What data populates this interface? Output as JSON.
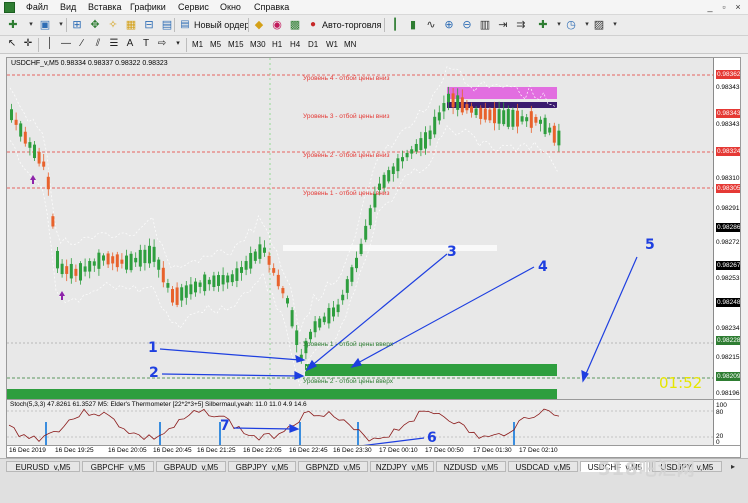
{
  "menu": {
    "items": [
      "Файл",
      "Вид",
      "Вставка",
      "Графики",
      "Сервис",
      "Окно",
      "Справка"
    ],
    "window_controls": [
      "_",
      "▫",
      "×"
    ]
  },
  "toolbar": {
    "new_order_label": "Новый ордер",
    "auto_trading_label": "Авто-торговля",
    "timeframes": [
      "M1",
      "M5",
      "M15",
      "M30",
      "H1",
      "H4",
      "D1",
      "W1",
      "MN"
    ]
  },
  "chart": {
    "title": "USDCHF_v,M5  0.98334 0.98337 0.98322 0.98323",
    "price_labels": [
      "0.98362",
      "0.98343",
      "0.98324",
      "0.98310",
      "0.98305",
      "0.98291",
      "0.98286",
      "0.98272",
      "0.98267",
      "0.98253",
      "0.98248",
      "0.98234",
      "0.98228",
      "0.98215",
      "0.98209",
      "0.98196"
    ],
    "levels": {
      "l4": "Уровень 4 - отбой цены вниз",
      "l3": "Уровень 3 - отбой цены вниз",
      "l2": "Уровень 2 - отбой цены вниз",
      "l1": "Уровень 1 - отбой цены вниз",
      "s1": "Уровень 1 - отбой цены вверх",
      "s2": "Уровень 2 - отбой цены вверх"
    },
    "annotations": [
      "1",
      "2",
      "3",
      "4",
      "5",
      "6",
      "7"
    ],
    "clock": "01:52"
  },
  "indicator": {
    "title": "Stoch(5,3,3) 47.8261 61.3527   M5: Elder's Thermometer [22*2*3+5] Silbermaul,yeah: 11.0 11.0 4.9 14.6",
    "axis_labels": [
      "100",
      "80",
      "20",
      "0"
    ]
  },
  "time_axis": {
    "labels": [
      "16 Dec 2019",
      "16 Dec 19:25",
      "16 Dec 20:05",
      "16 Dec 20:45",
      "16 Dec 21:25",
      "16 Dec 22:05",
      "16 Dec 22:45",
      "16 Dec 23:30",
      "17 Dec 00:10",
      "17 Dec 00:50",
      "17 Dec 01:30",
      "17 Dec 02:10"
    ]
  },
  "tabs": [
    "EURUSD_v,M5",
    "GBPCHF_v,M5",
    "GBPAUD_v,M5",
    "GBPJPY_v,M5",
    "GBPNZD_v,M5",
    "NZDJPY_v,M5",
    "NZDUSD_v,M5",
    "USDCAD_v,M5",
    "USDCHF_v,M5",
    "USDJPY_v,M5"
  ],
  "active_tab": "USDCHF_v,M5",
  "watermark": "518吧汇网",
  "colors": {
    "bull": "#2e9e3e",
    "bear": "#e8622c",
    "resistance": "#e53935",
    "support": "#2e7d32",
    "annotation": "#1e3fe0",
    "resistance_zone": "#e26ee0",
    "clock": "#e6e600"
  }
}
